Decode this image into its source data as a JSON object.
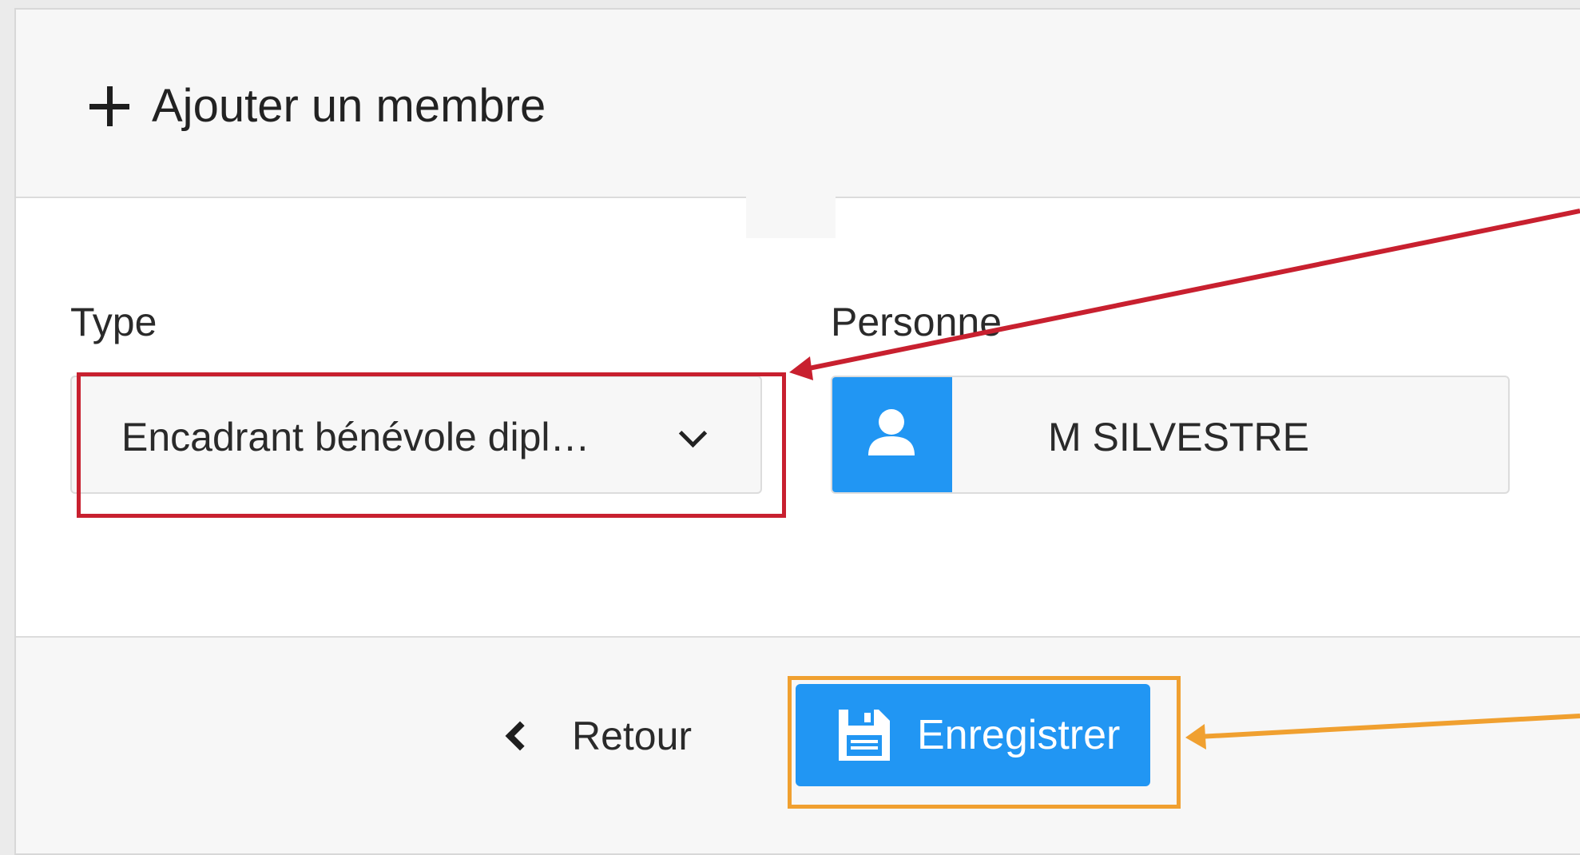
{
  "header": {
    "title": "Ajouter un membre",
    "title_icon": "plus-icon"
  },
  "form": {
    "type": {
      "label": "Type",
      "value": "Encadrant bénévole dipl…",
      "icon": "chevron-down-icon"
    },
    "person": {
      "label": "Personne",
      "value": "M SILVESTRE",
      "icon": "user-icon"
    }
  },
  "footer": {
    "back_label": "Retour",
    "back_icon": "chevron-left-icon",
    "save_label": "Enregistrer",
    "save_icon": "floppy-disk-icon"
  },
  "colors": {
    "primary": "#2196f3",
    "annotation_red": "#c8202f",
    "annotation_orange": "#f0a030"
  }
}
